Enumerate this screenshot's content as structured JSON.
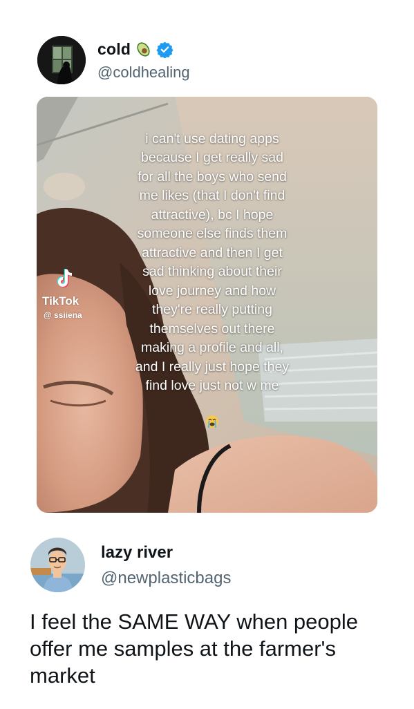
{
  "tweet": {
    "display_name": "cold",
    "handle": "@coldhealing",
    "name_emoji": "avocado-emoji",
    "verified": true,
    "media": {
      "overlay_text": "i can't use dating apps\nbecause I get really sad\nfor all the boys who send\nme likes (that I don't find\nattractive), bc I hope\nsomeone else finds them\nattractive and then I get\nsad thinking about their\nlove journey and how\nthey're really putting\nthemselves out there\nmaking a profile and all,\nand I really just hope they\nfind love just not w me",
      "overlay_emoji": "loudly-crying-face-emoji",
      "watermark_brand": "TikTok",
      "watermark_user": "@ ssiiena"
    }
  },
  "reply": {
    "display_name": "lazy river",
    "handle": "@newplasticbags",
    "text": " I feel the SAME WAY when people offer me samples at the farmer's market"
  },
  "colors": {
    "text_primary": "#0f1419",
    "text_secondary": "#536471",
    "verified_blue": "#1d9bf0"
  }
}
